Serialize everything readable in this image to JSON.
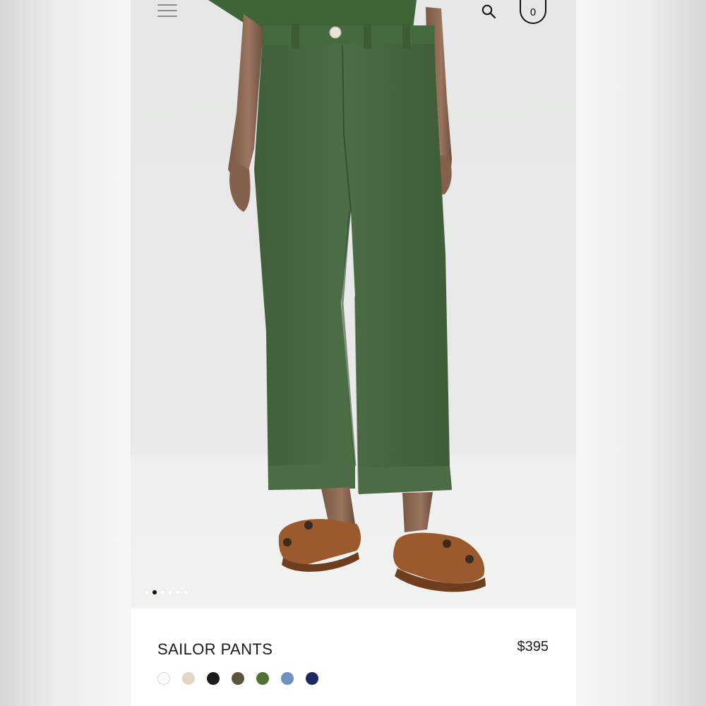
{
  "header": {
    "menu_icon": "hamburger-menu-icon",
    "search_icon": "search-icon",
    "cart_icon": "shopping-bag-icon",
    "cart_count": "0"
  },
  "gallery": {
    "image_count": 6,
    "active_index": 1,
    "pants_color": "#4a6a43",
    "sandal_color": "#9b5a2d"
  },
  "product": {
    "title": "SAILOR PANTS",
    "price": "$395",
    "swatches": [
      {
        "name": "white",
        "color": "#fbfbfb"
      },
      {
        "name": "natural",
        "color": "#e2d6c5"
      },
      {
        "name": "black",
        "color": "#1b1b1b"
      },
      {
        "name": "olive",
        "color": "#58553f"
      },
      {
        "name": "green",
        "color": "#4f7135"
      },
      {
        "name": "blue",
        "color": "#6f92bd"
      },
      {
        "name": "navy",
        "color": "#1d2960"
      }
    ]
  }
}
